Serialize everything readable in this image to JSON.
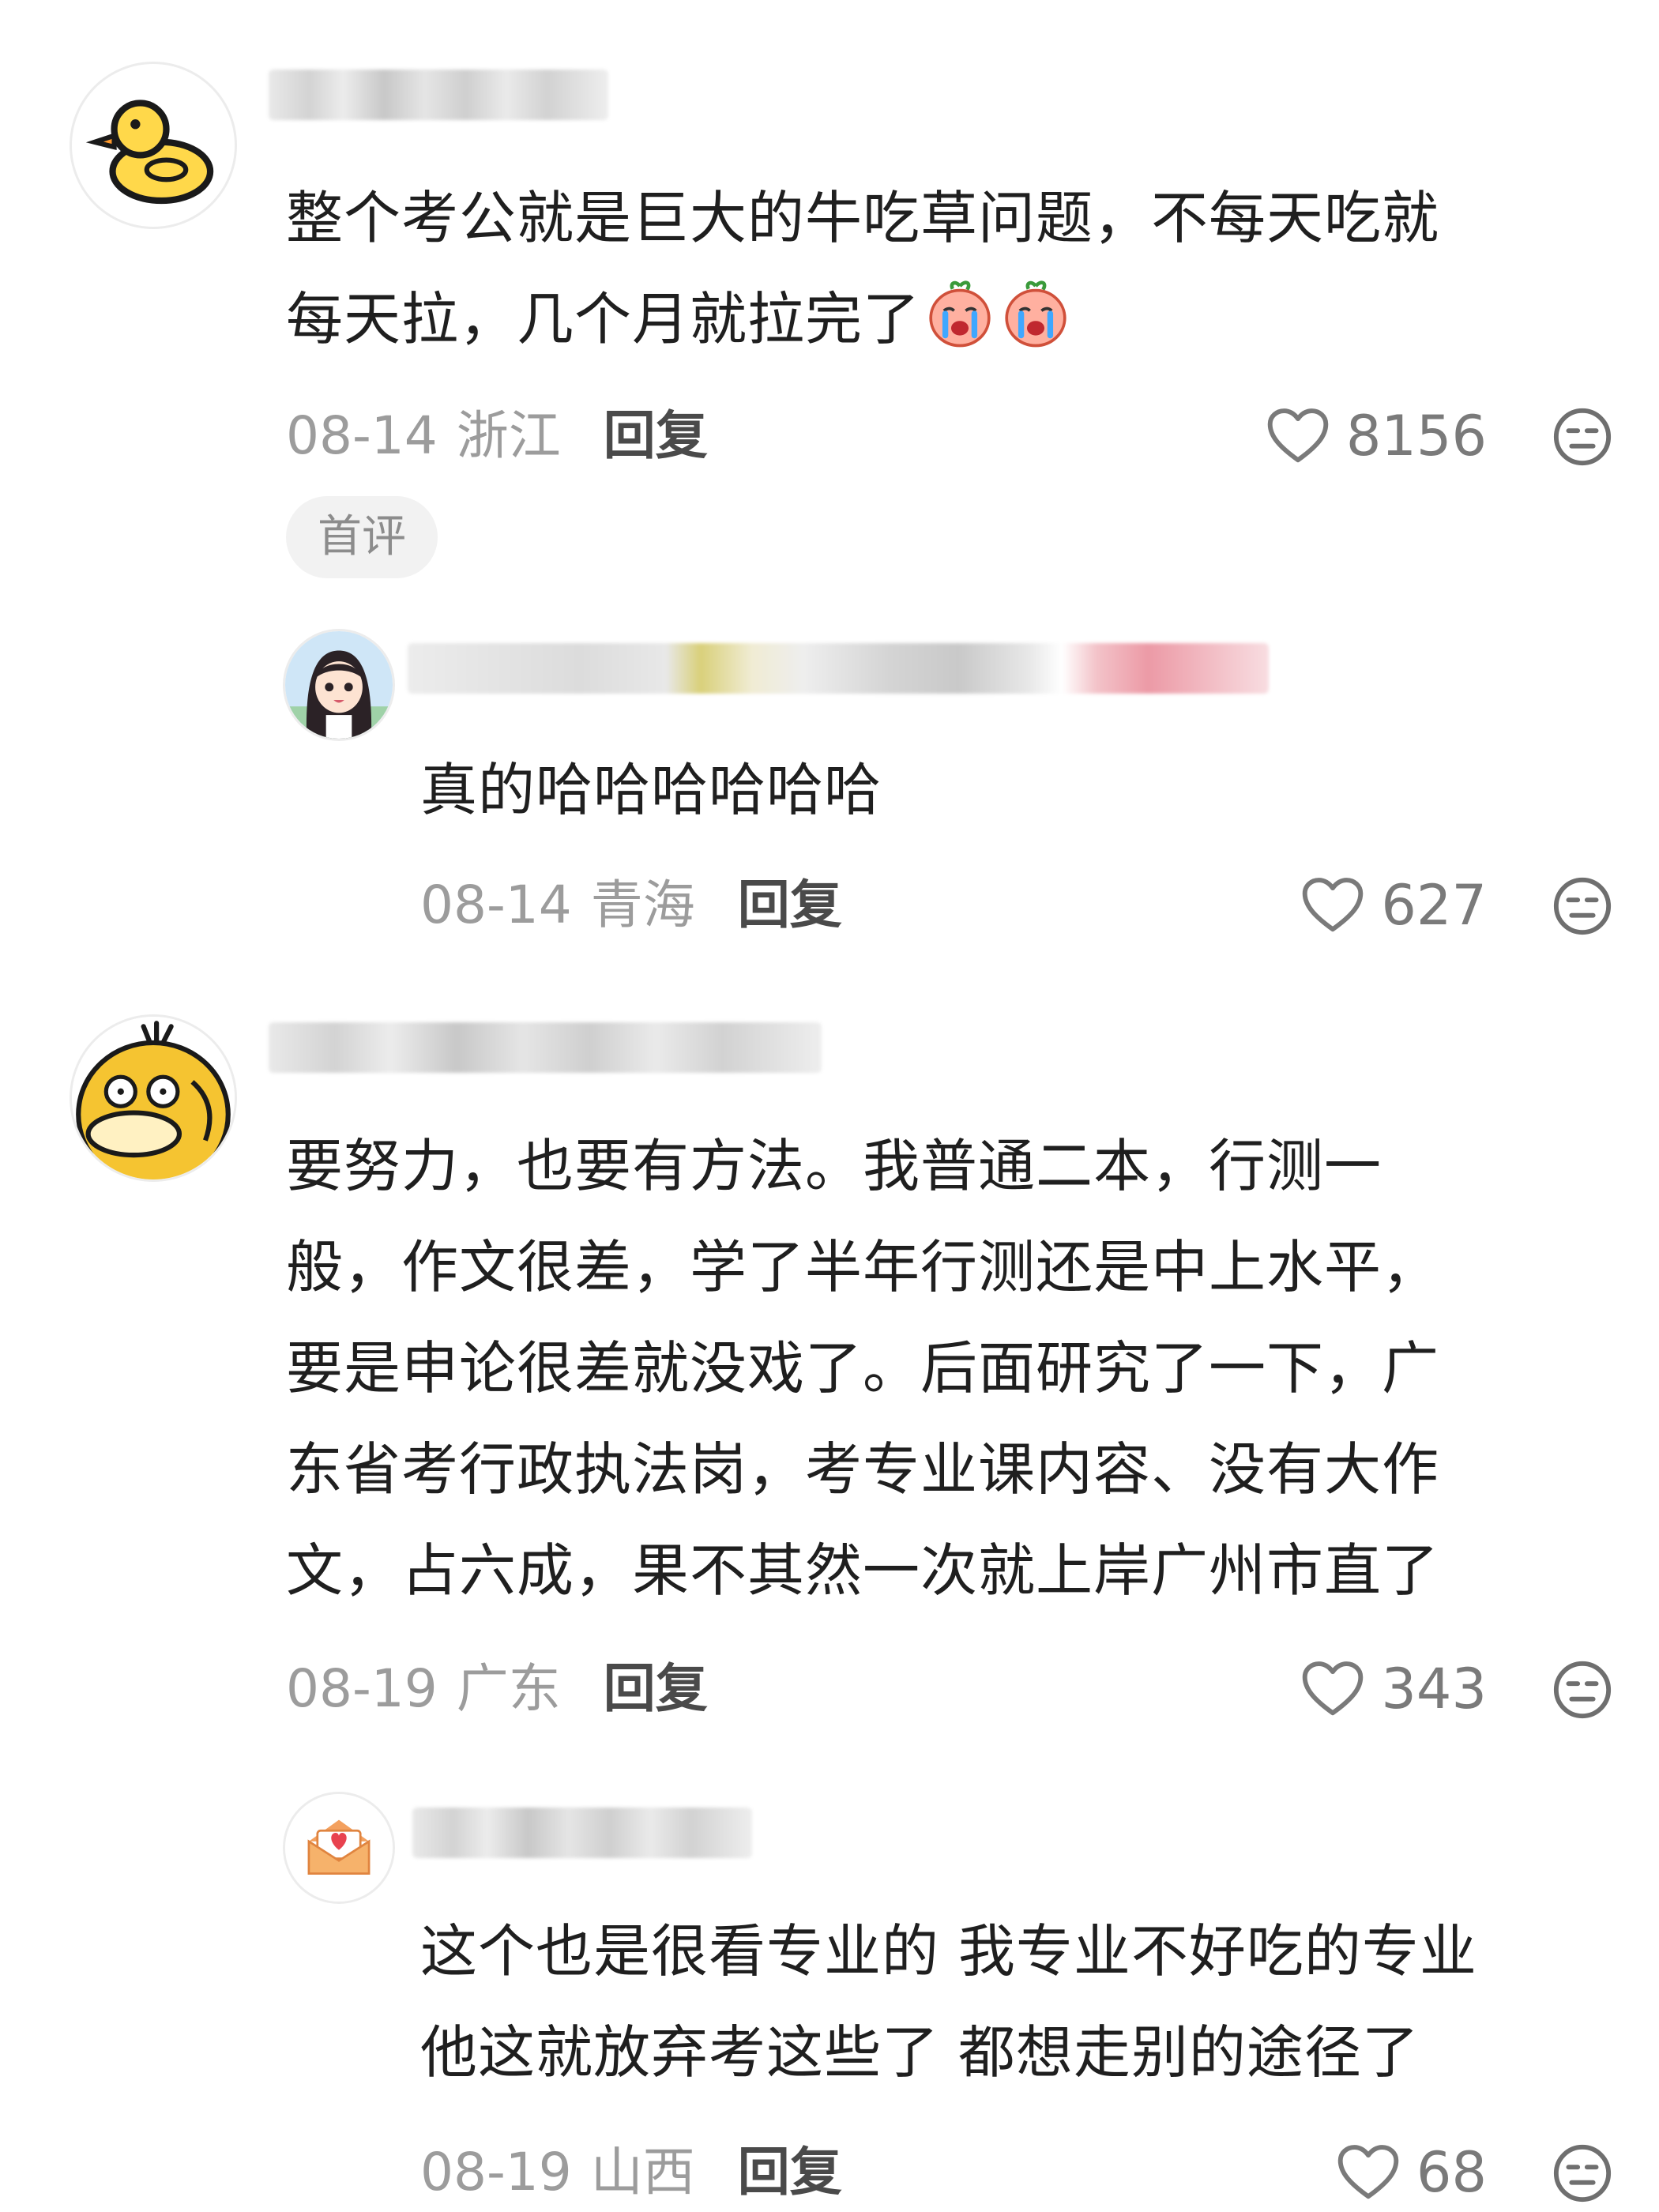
{
  "comments": [
    {
      "avatar": "yellow-duck-avatar",
      "text_line1": "整个考公就是巨大的牛吃草问题，不每天吃就",
      "text_line2": "每天拉，几个月就拉完了",
      "inline_emojis": [
        "crying-peach-emoji",
        "crying-peach-emoji"
      ],
      "date": "08-14",
      "region": "浙江",
      "reply_label": "回复",
      "likes": "8156",
      "badge": "首评",
      "replies": [
        {
          "avatar": "anime-girl-avatar",
          "text": "真的哈哈哈哈哈哈",
          "date": "08-14",
          "region": "青海",
          "reply_label": "回复",
          "likes": "627"
        }
      ]
    },
    {
      "avatar": "psyduck-avatar",
      "lines": [
        "要努力，也要有方法。我普通二本，行测一",
        "般，作文很差，学了半年行测还是中上水平，",
        "要是申论很差就没戏了。后面研究了一下，广",
        "东省考行政执法岗，考专业课内容、没有大作",
        "文，占六成，果不其然一次就上岸广州市直了"
      ],
      "date": "08-19",
      "region": "广东",
      "reply_label": "回复",
      "likes": "343",
      "replies": [
        {
          "avatar": "love-letter-avatar",
          "lines": [
            "这个也是很看专业的 我专业不好吃的专业",
            "他这就放弃考这些了 都想走别的途径了"
          ],
          "date": "08-19",
          "region": "山西",
          "reply_label": "回复",
          "likes": "68"
        }
      ]
    }
  ],
  "colors": {
    "meta_gray": "#9c9c9c",
    "reply_dark": "#4a4a4a",
    "badge_bg": "#f2f2f2",
    "duck_yellow": "#ffd84a"
  },
  "icons": [
    "heart-outline-icon",
    "neutral-face-icon"
  ]
}
